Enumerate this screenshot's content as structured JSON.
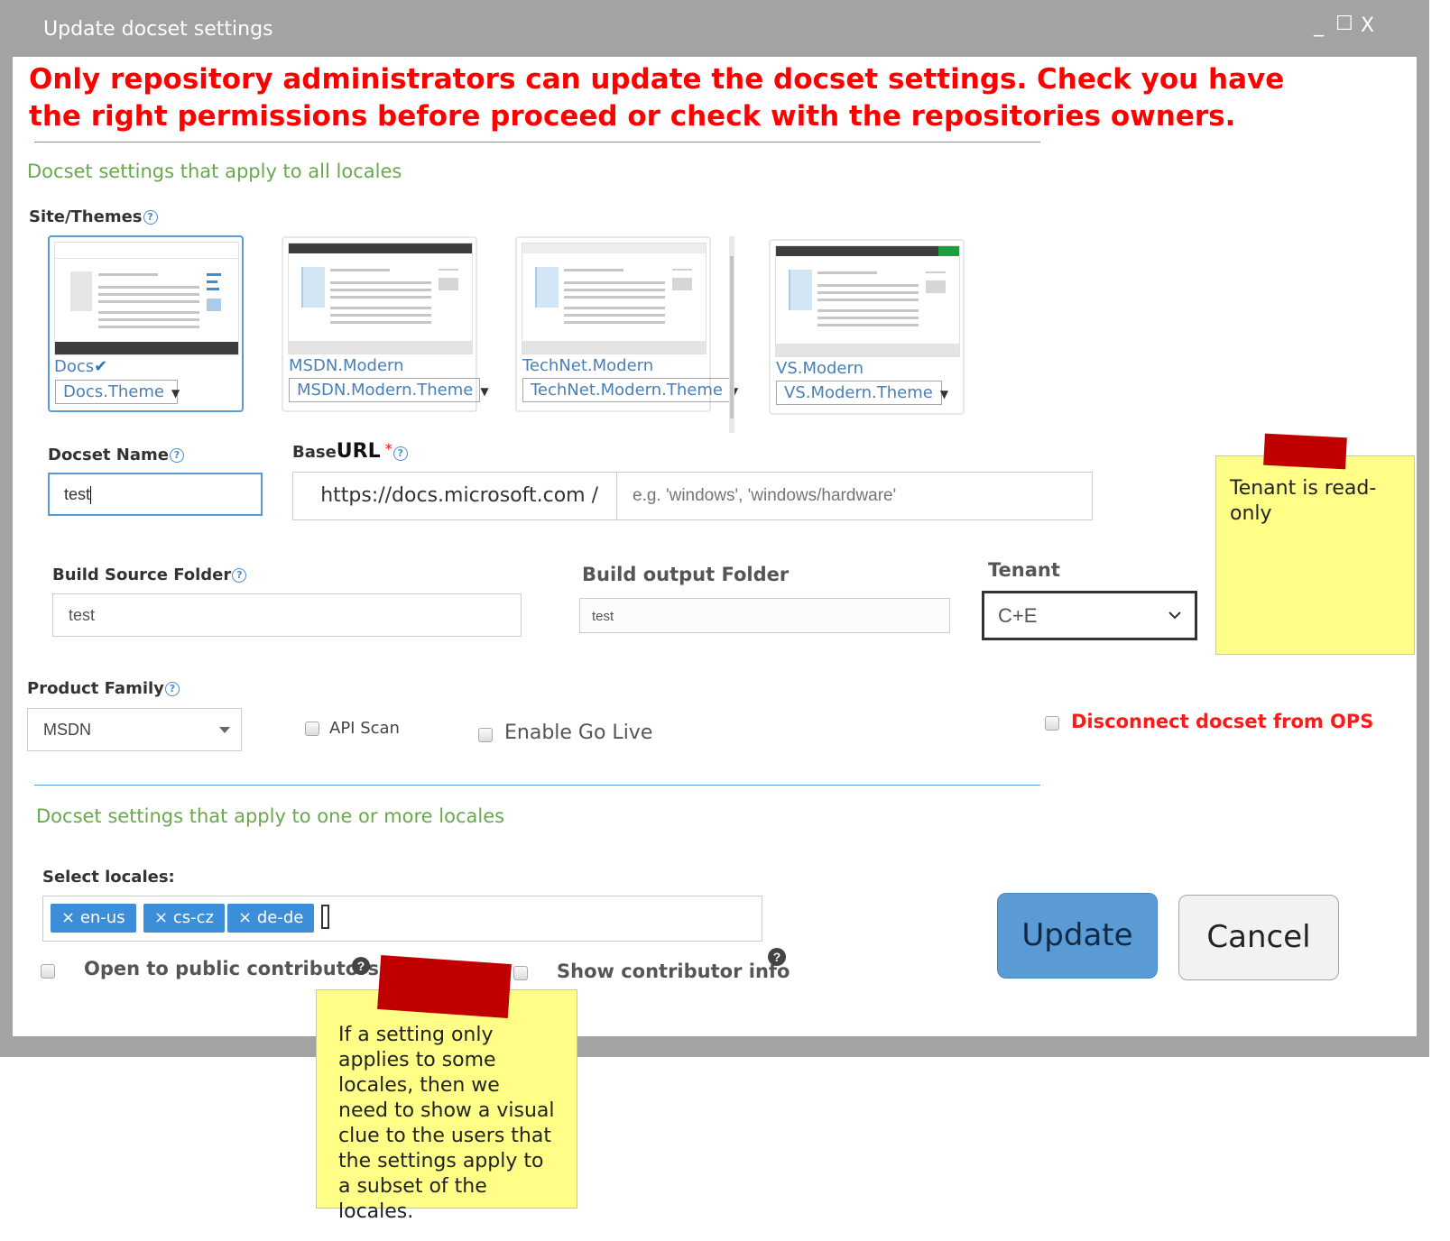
{
  "window": {
    "title": "Update docset settings",
    "controls": {
      "minimize": "_",
      "maximize": "☐",
      "close": "X"
    }
  },
  "warning": "Only repository administrators can update the docset settings. Check you have the right permissions before proceed or check with the repositories owners.",
  "section_all_locales": "Docset settings that apply to all locales",
  "site_themes": {
    "label": "Site/Themes",
    "themes": [
      {
        "name": "Docs",
        "theme": "Docs.Theme",
        "selected": true
      },
      {
        "name": "MSDN.Modern",
        "theme": "MSDN.Modern.Theme",
        "selected": false
      },
      {
        "name": "TechNet.Modern",
        "theme": "TechNet.Modern.Theme",
        "selected": false
      },
      {
        "name": "VS.Modern",
        "theme": "VS.Modern.Theme",
        "selected": false
      }
    ]
  },
  "docset_name": {
    "label": "Docset Name",
    "value": "test"
  },
  "base_url": {
    "label_prefix": "Base",
    "label_bold": "URL",
    "required_mark": "*",
    "prefix": "https://docs.microsoft.com /",
    "placeholder": "e.g. 'windows', 'windows/hardware'"
  },
  "build_source_folder": {
    "label": "Build Source Folder",
    "value": "test"
  },
  "build_output_folder": {
    "label": "Build output Folder",
    "value": "test"
  },
  "tenant": {
    "label": "Tenant",
    "value": "C+E"
  },
  "product_family": {
    "label": "Product Family",
    "value": "MSDN"
  },
  "api_scan": {
    "label": "API Scan",
    "checked": false
  },
  "enable_go_live": {
    "label": "Enable Go Live",
    "checked": false
  },
  "disconnect": {
    "label": "Disconnect docset from OPS",
    "checked": false
  },
  "section_locales": "Docset settings that apply to one or more locales",
  "select_locales": {
    "label": "Select locales",
    "tags": [
      "en-us",
      "cs-cz",
      "de-de"
    ],
    "remove_glyph": "×"
  },
  "open_public": {
    "label": "Open to public contributors",
    "checked": false
  },
  "show_contributor": {
    "label": "Show contributor info",
    "checked": false
  },
  "buttons": {
    "update": "Update",
    "cancel": "Cancel"
  },
  "notes": {
    "tenant": "Tenant is read-only",
    "locales": "If a setting only applies to some locales, then we need to show a visual clue to the users that the settings apply to a subset of the locales."
  },
  "colors": {
    "accent": "#5b9bd5",
    "warning": "#ff0000",
    "section": "#6aa84f",
    "update_button": "#5b9bd5",
    "sticky": "#ffff88",
    "tape": "#c00000"
  }
}
